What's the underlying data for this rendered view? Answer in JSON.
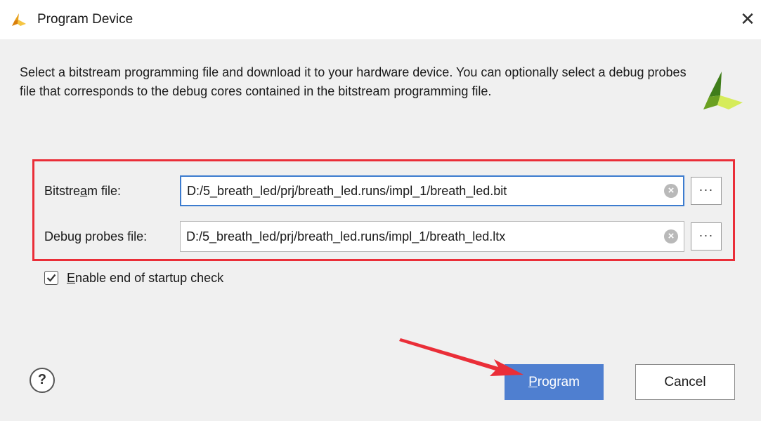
{
  "window": {
    "title": "Program Device",
    "close_glyph": "✕"
  },
  "description": "Select a bitstream programming file and download it to your hardware device. You can optionally select a debug probes file that corresponds to the debug cores contained in the bitstream programming file.",
  "fields": {
    "bitstream": {
      "label_pre": "Bitstre",
      "label_mnemonic": "a",
      "label_post": "m file:",
      "value": "D:/5_breath_led/prj/breath_led.runs/impl_1/breath_led.bit",
      "browse_label": "···"
    },
    "debug": {
      "label_pre": "Debu",
      "label_mnemonic": "g",
      "label_post": " probes file:",
      "value": "D:/5_breath_led/prj/breath_led.runs/impl_1/breath_led.ltx",
      "browse_label": "···"
    }
  },
  "startup_check": {
    "checked": true,
    "label_mnemonic": "E",
    "label_rest": "nable end of startup check"
  },
  "footer": {
    "help_label": "?",
    "program_mnemonic": "P",
    "program_rest": "rogram",
    "cancel_label": "Cancel"
  },
  "colors": {
    "highlight": "#ea2e38",
    "primary_button": "#4f7fd0",
    "focus_border": "#3c7ccf",
    "brand_green": "#6aa021",
    "brand_yellow": "#d6ec5a"
  },
  "icons": {
    "app_logo": "xilinx-logo-icon",
    "clear": "clear-x-icon",
    "checkbox": "check-icon",
    "annotation": "red-arrow-icon"
  }
}
